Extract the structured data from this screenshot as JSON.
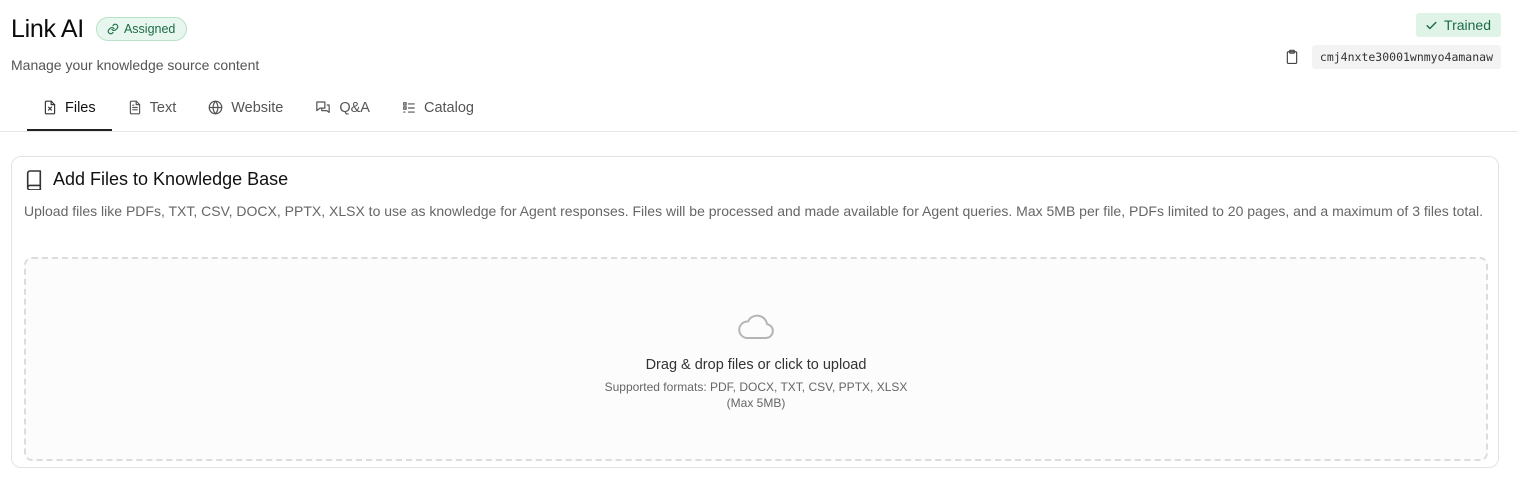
{
  "header": {
    "title": "Link AI",
    "assigned_badge": "Assigned",
    "subtitle": "Manage your knowledge source content",
    "trained_badge": "Trained",
    "source_id": "cmj4nxte30001wnmyo4amanaw"
  },
  "tabs": [
    {
      "label": "Files",
      "icon": "file-x-icon",
      "active": true
    },
    {
      "label": "Text",
      "icon": "file-text-icon",
      "active": false
    },
    {
      "label": "Website",
      "icon": "globe-icon",
      "active": false
    },
    {
      "label": "Q&A",
      "icon": "chat-icon",
      "active": false
    },
    {
      "label": "Catalog",
      "icon": "list-icon",
      "active": false
    }
  ],
  "card": {
    "title": "Add Files to Knowledge Base",
    "description": "Upload files like PDFs, TXT, CSV, DOCX, PPTX, XLSX to use as knowledge for Agent responses. Files will be processed and made available for Agent queries. Max 5MB per file, PDFs limited to 20 pages, and a maximum of 3 files total.",
    "dropzone": {
      "title": "Drag & drop files or click to upload",
      "formats": "Supported formats: PDF, DOCX, TXT, CSV, PPTX, XLSX",
      "max": "(Max 5MB)"
    }
  },
  "colors": {
    "accent_green": "#1d6b45",
    "badge_bg": "#e7f6ee",
    "trained_bg": "#dff3e6"
  }
}
